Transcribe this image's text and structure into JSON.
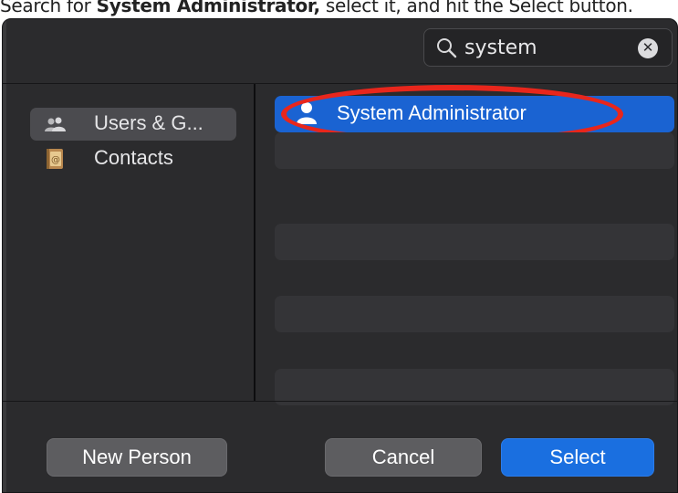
{
  "instruction": {
    "prefix": "Search for ",
    "emphasis": "System Administrator,",
    "suffix": " select it, and hit the Select button."
  },
  "search": {
    "value": "system",
    "placeholder": "Search",
    "icon": "search-icon",
    "clear_icon": "clear-icon"
  },
  "sidebar": {
    "items": [
      {
        "label": "Users & G...",
        "icon": "users-groups-icon",
        "selected": true
      },
      {
        "label": "Contacts",
        "icon": "contacts-book-icon",
        "selected": false
      }
    ]
  },
  "results": {
    "rows": [
      {
        "label": "System Administrator",
        "icon": "person-icon",
        "selected": true
      },
      {
        "label": ""
      },
      {
        "label": ""
      },
      {
        "label": ""
      },
      {
        "label": ""
      },
      {
        "label": ""
      }
    ]
  },
  "buttons": {
    "new_person": "New Person",
    "cancel": "Cancel",
    "select": "Select"
  },
  "colors": {
    "window_bg": "#2b2b2d",
    "selection_blue": "#1a63d2",
    "primary_button": "#1a6fe0",
    "annotation_red": "#e8261c"
  }
}
